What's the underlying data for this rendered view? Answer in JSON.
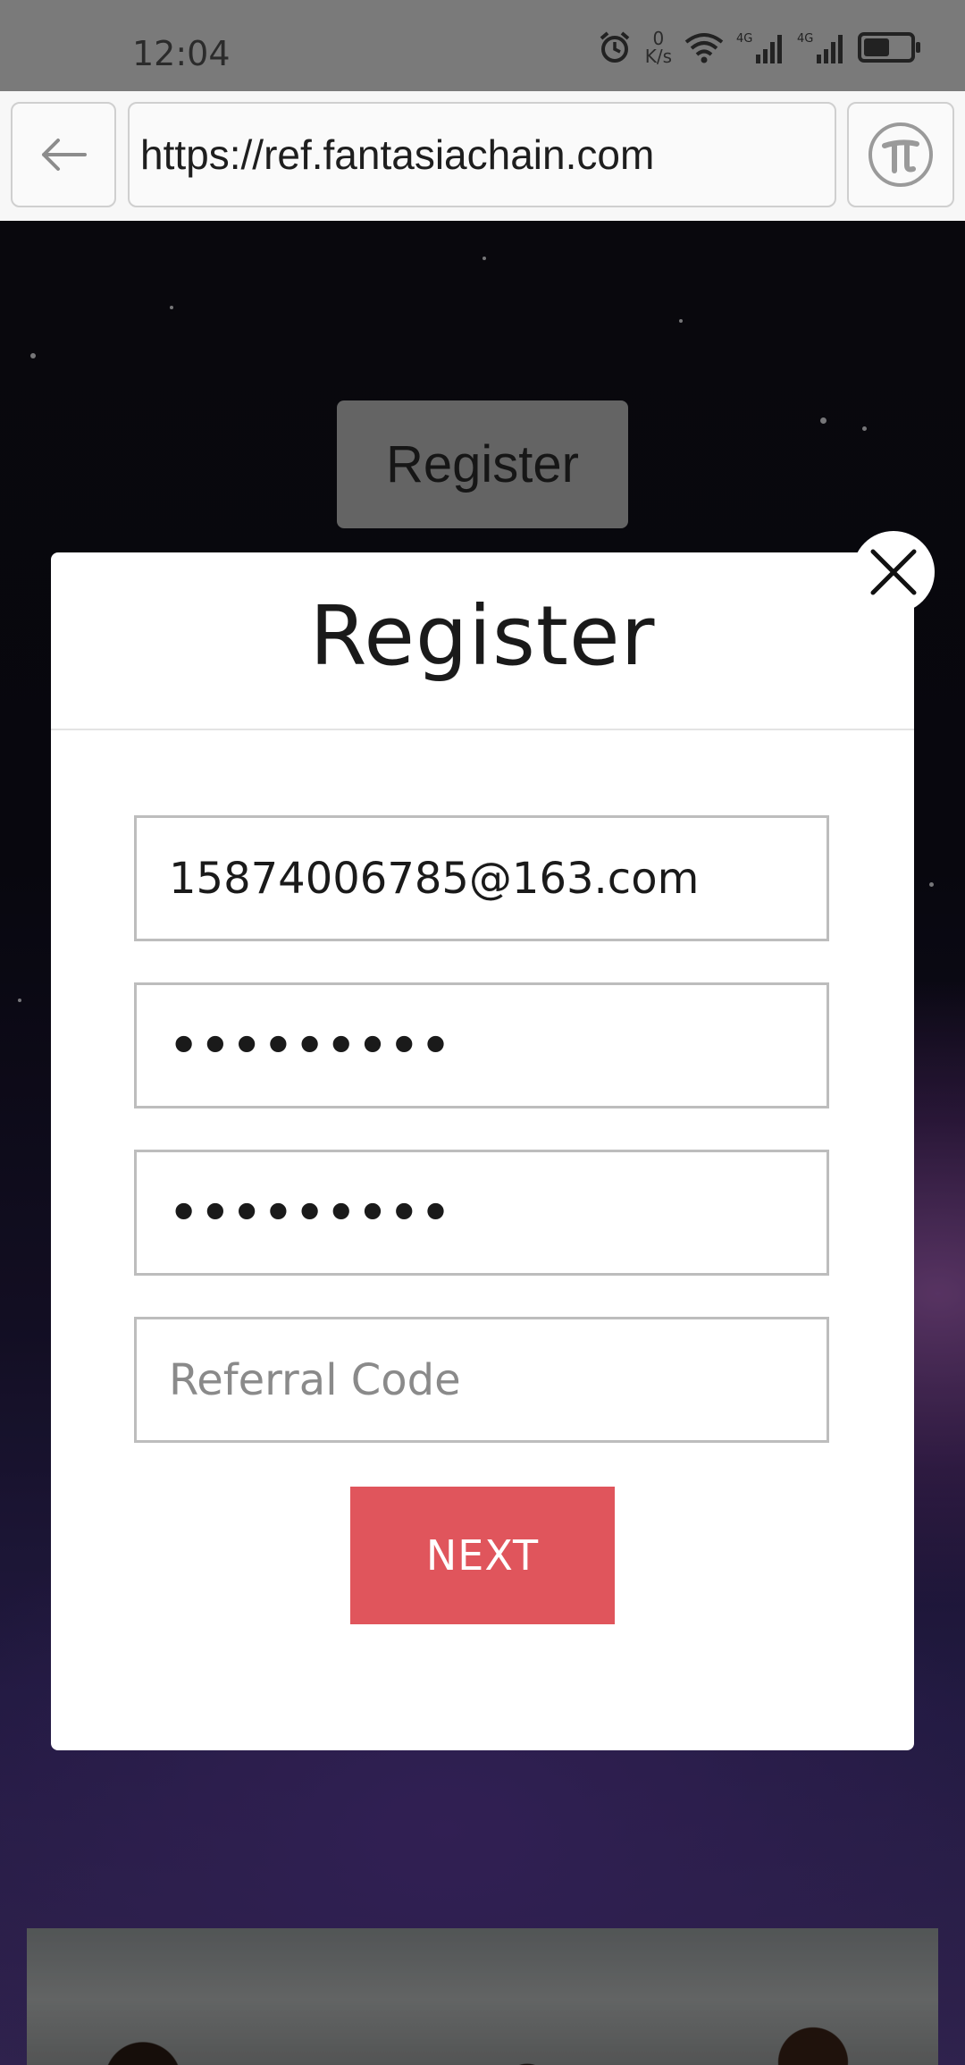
{
  "status_bar": {
    "time": "12:04",
    "net_speed_value": "0",
    "net_speed_unit": "K/s",
    "icons": [
      "alarm-icon",
      "wifi-icon",
      "signal-4g-icon",
      "signal-4g-icon",
      "battery-icon"
    ],
    "battery_level": 0.55
  },
  "browser": {
    "url": "https://ref.fantasiachain.com",
    "back_icon": "arrow-left-icon",
    "pi_icon": "pi-logo-icon"
  },
  "page": {
    "register_button_label": "Register"
  },
  "modal": {
    "title": "Register",
    "email_value": "15874006785@163.com",
    "password_value": "•••••••••",
    "confirm_password_value": "•••••••••",
    "referral_placeholder": "Referral Code",
    "next_label": "NEXT",
    "accent_color": "#e0555c"
  }
}
